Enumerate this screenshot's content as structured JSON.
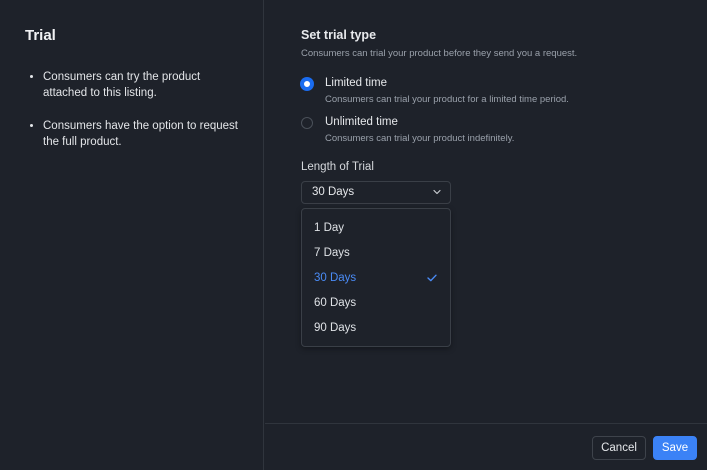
{
  "sidebar": {
    "title": "Trial",
    "bullets": [
      "Consumers can try the product attached to this listing.",
      "Consumers have the option to request the full product."
    ]
  },
  "trial_type": {
    "title": "Set trial type",
    "description": "Consumers can trial your product before they send you a request.",
    "options": [
      {
        "label": "Limited time",
        "description": "Consumers can trial your product for a limited time period.",
        "selected": true
      },
      {
        "label": "Unlimited time",
        "description": "Consumers can trial your product indefinitely.",
        "selected": false
      }
    ]
  },
  "length": {
    "label": "Length of Trial",
    "selected": "30 Days",
    "options": [
      "1 Day",
      "7 Days",
      "30 Days",
      "60 Days",
      "90 Days"
    ],
    "chevron_icon": "chevron-down-icon",
    "check_icon": "check-icon"
  },
  "footer": {
    "cancel_label": "Cancel",
    "save_label": "Save"
  },
  "colors": {
    "background": "#1e222a",
    "accent": "#3b82f6",
    "selected_text": "#4a8bf5",
    "muted_text": "#9aa1ab"
  }
}
